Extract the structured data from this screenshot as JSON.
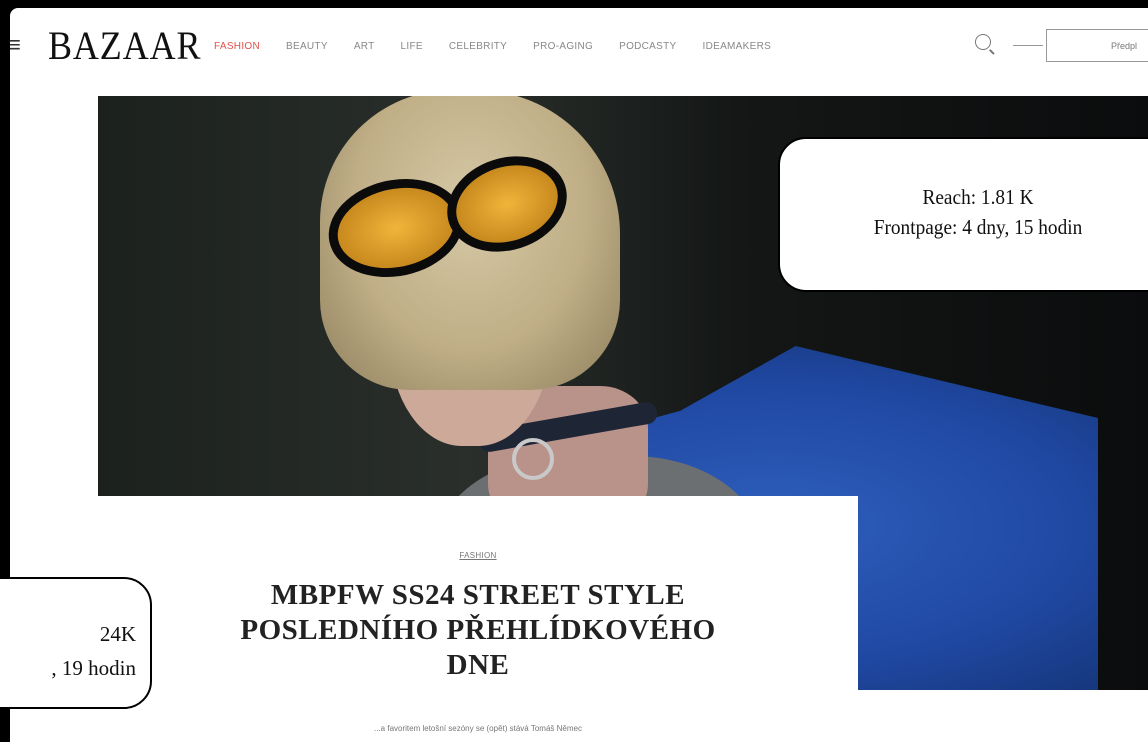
{
  "header": {
    "logo": "BAZAAR",
    "nav": [
      {
        "label": "FASHION",
        "active": true
      },
      {
        "label": "BEAUTY",
        "active": false
      },
      {
        "label": "ART",
        "active": false
      },
      {
        "label": "LIFE",
        "active": false
      },
      {
        "label": "CELEBRITY",
        "active": false
      },
      {
        "label": "PRO-AGING",
        "active": false
      },
      {
        "label": "PODCASTY",
        "active": false
      },
      {
        "label": "IDEAMAKERS",
        "active": false
      }
    ],
    "subscribe_label": "Předpl"
  },
  "article": {
    "category": "FASHION",
    "title_line1": "MBPFW SS24 STREET STYLE",
    "title_line2": "POSLEDNÍHO PŘEHLÍDKOVÉHO",
    "title_line3": "DNE",
    "perex": "...a favoritem letošní sezóny se (opět) stává Tomáš Němec"
  },
  "overlays": {
    "right": {
      "reach": "Reach: 1.81 K",
      "frontpage": "Frontpage: 4 dny, 15 hodin"
    },
    "left": {
      "reach": "24K",
      "frontpage": ", 19 hodin"
    }
  },
  "colors": {
    "accent": "#e2504a",
    "coat": "#1f48a2",
    "lens": "#f1b43a"
  }
}
